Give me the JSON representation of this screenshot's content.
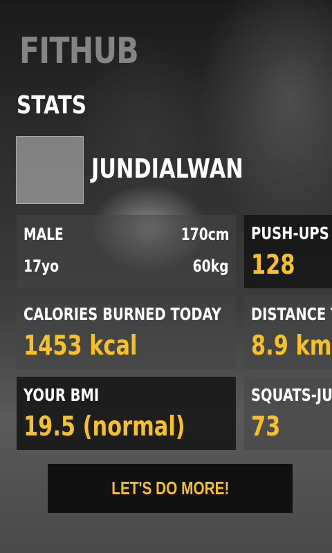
{
  "app": {
    "brand": "FITHUB",
    "section_title": "STATS"
  },
  "profile": {
    "username": "JUNDIALWAN",
    "gender": "MALE",
    "height": "170cm",
    "age": "17yo",
    "weight": "60kg"
  },
  "stats": {
    "pushups": {
      "label": "PUSH-UPS TO",
      "value": "128"
    },
    "calories": {
      "label": "CALORIES BURNED TODAY",
      "value": "1453 kcal"
    },
    "distance": {
      "label": "DISTANCE TO",
      "value": "8.9 km"
    },
    "bmi": {
      "label": "YOUR BMI",
      "value": "19.5 (normal)"
    },
    "squats": {
      "label": "SQUATS-JUM",
      "value": "73"
    }
  },
  "cta": {
    "label": "LET'S DO MORE!"
  },
  "colors": {
    "accent": "#f6c026",
    "card_dark": "#161616",
    "card_light": "#464646"
  }
}
